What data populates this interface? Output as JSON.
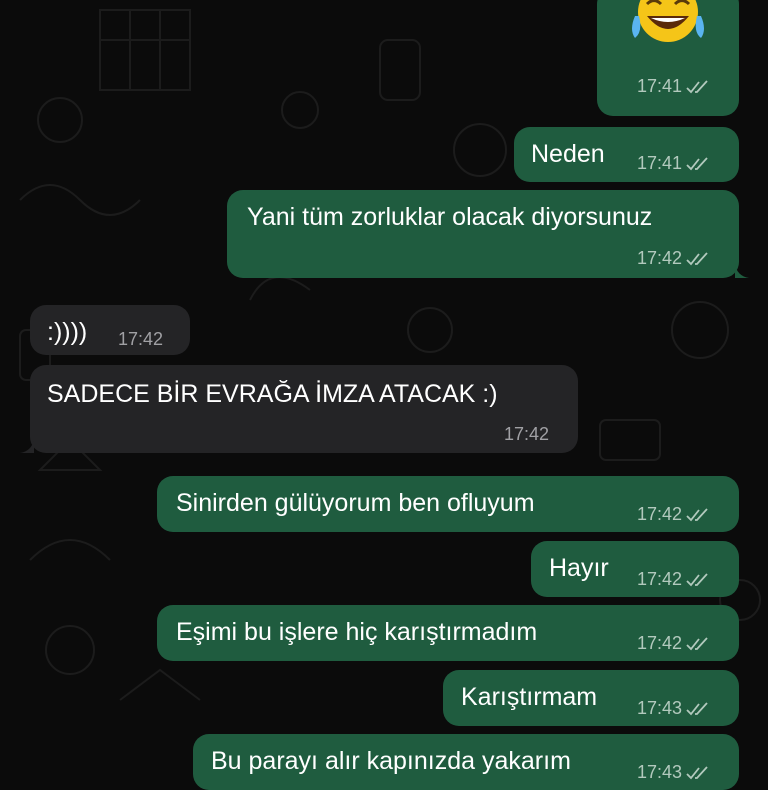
{
  "chat": {
    "messages": [
      {
        "id": "m0",
        "dir": "out",
        "emoji": "😂",
        "time": "17:41",
        "status": "read"
      },
      {
        "id": "m1",
        "dir": "out",
        "text": "Neden",
        "time": "17:41",
        "status": "read"
      },
      {
        "id": "m2",
        "dir": "out",
        "text": "Yani tüm zorluklar olacak diyorsunuz",
        "time": "17:42",
        "status": "read"
      },
      {
        "id": "m3",
        "dir": "in",
        "text": ":))))",
        "time": "17:42"
      },
      {
        "id": "m4",
        "dir": "in",
        "text": "SADECE BİR EVRAĞA İMZA ATACAK :)",
        "time": "17:42"
      },
      {
        "id": "m5",
        "dir": "out",
        "text": "Sinirden gülüyorum ben ofluyum",
        "time": "17:42",
        "status": "read"
      },
      {
        "id": "m6",
        "dir": "out",
        "text": "Hayır",
        "time": "17:42",
        "status": "read"
      },
      {
        "id": "m7",
        "dir": "out",
        "text": "Eşimi bu işlere hiç karıştırmadım",
        "time": "17:42",
        "status": "read"
      },
      {
        "id": "m8",
        "dir": "out",
        "text": "Karıştırmam",
        "time": "17:43",
        "status": "read"
      },
      {
        "id": "m9",
        "dir": "out",
        "text": "Bu parayı alır kapınızda yakarım",
        "time": "17:43",
        "status": "read"
      }
    ]
  },
  "colors": {
    "outgoing_bubble": "#1f5c3f",
    "incoming_bubble": "#242426",
    "background": "#0b0b0b",
    "read_ticks": "#b2c9bd"
  },
  "icons": {
    "read_receipt": "double-check-icon",
    "emoji": "tears-of-joy-emoji"
  }
}
